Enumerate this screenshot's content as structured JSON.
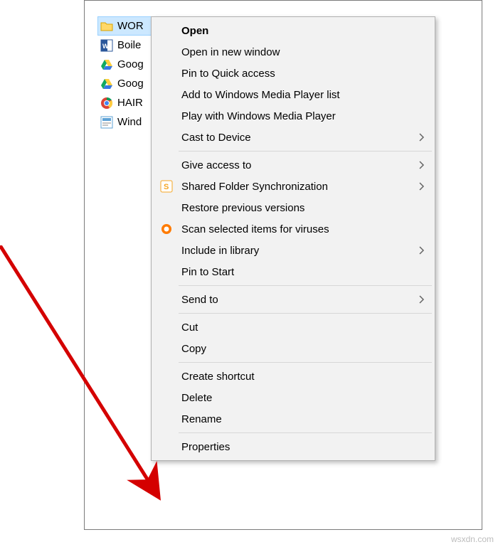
{
  "files": [
    {
      "label": "WOR",
      "icon": "folder",
      "selected": true
    },
    {
      "label": "Boile",
      "icon": "word",
      "selected": false
    },
    {
      "label": "Goog",
      "icon": "gdrive",
      "selected": false
    },
    {
      "label": "Goog",
      "icon": "gdrive",
      "selected": false
    },
    {
      "label": "HAIR",
      "icon": "chrome",
      "selected": false
    },
    {
      "label": "Wind",
      "icon": "app",
      "selected": false
    }
  ],
  "menu": {
    "open": "Open",
    "open_new_window": "Open in new window",
    "pin_quick_access": "Pin to Quick access",
    "add_wmp_list": "Add to Windows Media Player list",
    "play_wmp": "Play with Windows Media Player",
    "cast_to_device": "Cast to Device",
    "give_access_to": "Give access to",
    "shared_folder_sync": "Shared Folder Synchronization",
    "restore_previous": "Restore previous versions",
    "scan_viruses": "Scan selected items for viruses",
    "include_library": "Include in library",
    "pin_to_start": "Pin to Start",
    "send_to": "Send to",
    "cut": "Cut",
    "copy": "Copy",
    "create_shortcut": "Create shortcut",
    "delete": "Delete",
    "rename": "Rename",
    "properties": "Properties"
  },
  "watermark": "wsxdn.com"
}
